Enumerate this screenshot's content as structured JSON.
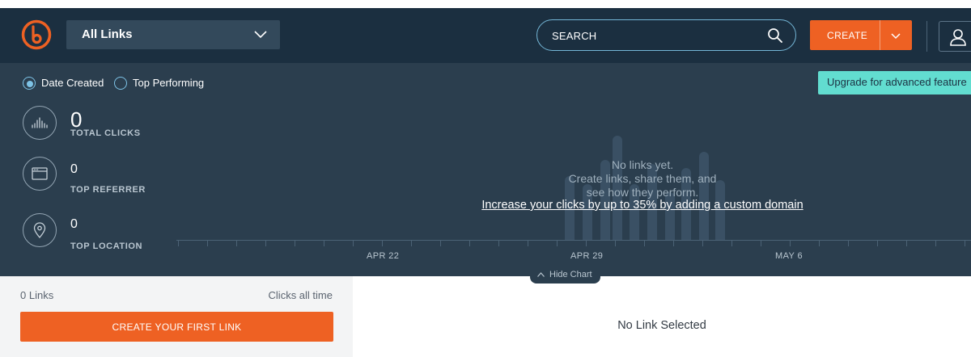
{
  "header": {
    "links_filter": "All Links",
    "search_placeholder": "SEARCH",
    "create_label": "CREATE"
  },
  "chart_controls": {
    "radio_options": [
      {
        "label": "Date Created",
        "selected": true
      },
      {
        "label": "Top Performing",
        "selected": false
      }
    ],
    "upgrade_label": "Upgrade for advanced feature"
  },
  "stats": {
    "total_clicks": {
      "value": "0",
      "label": "TOTAL CLICKS"
    },
    "top_referrer": {
      "value": "0",
      "label": "TOP REFERRER"
    },
    "top_location": {
      "value": "0",
      "label": "TOP LOCATION"
    }
  },
  "chart": {
    "empty_title": "No links yet.",
    "empty_line1": "Create links, share them, and",
    "empty_line2": "see how they perform.",
    "promo_link": "Increase your clicks by up to 35% by adding a custom domain",
    "x_labels": [
      "APR 22",
      "APR 29",
      "MAY 6"
    ],
    "hide_chart_label": "Hide Chart"
  },
  "list_panel": {
    "count_label": "0 Links",
    "sort_label": "Clicks all time",
    "create_first_label": "CREATE YOUR FIRST LINK"
  },
  "detail_panel": {
    "empty_label": "No Link Selected"
  },
  "colors": {
    "header_bg": "#1b2f40",
    "chart_bg": "#2b3e4e",
    "accent_orange": "#ee6123",
    "upgrade_teal": "#62ddd0",
    "radio_blue": "#7ec3e6"
  },
  "icons": [
    "bitly-logo-icon",
    "chevron-down-icon",
    "search-icon",
    "user-icon",
    "bar-chart-icon",
    "browser-window-icon",
    "map-pin-icon",
    "chevron-up-icon"
  ]
}
